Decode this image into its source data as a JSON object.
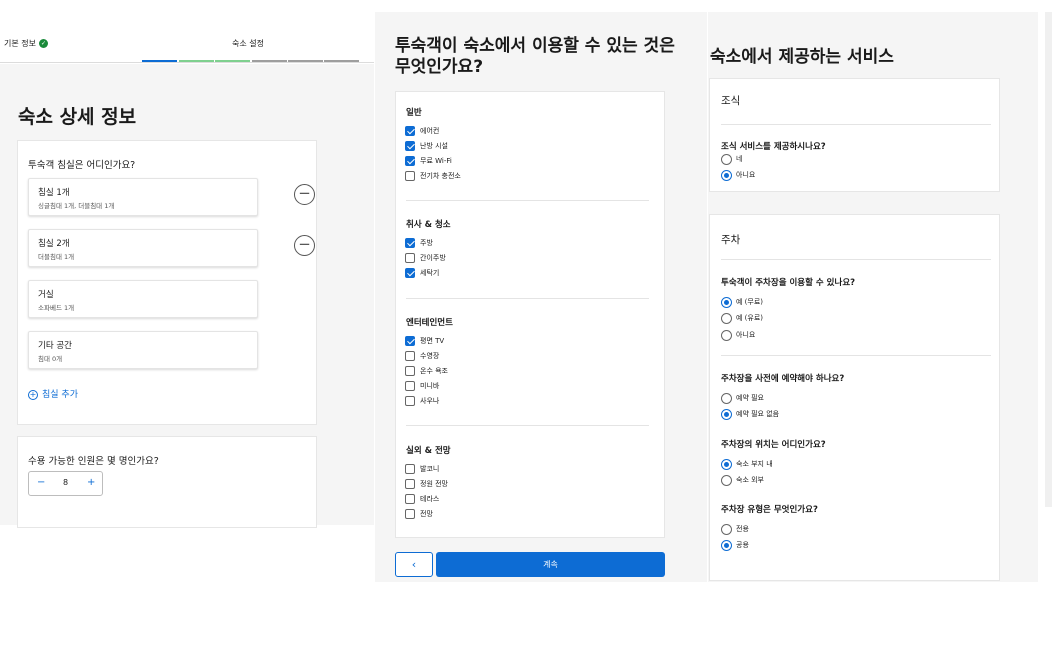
{
  "panel1": {
    "steps": {
      "basic": "기본 정보",
      "settings": "숙소 설정"
    },
    "step_colors": [
      "#0d6cd4",
      "#7fd08f",
      "#7fd08f",
      "#9e9e9e",
      "#9e9e9e",
      "#9e9e9e"
    ],
    "title": "숙소 상세 정보",
    "rooms_question": "투숙객 침실은 어디인가요?",
    "rooms": [
      {
        "title": "침실 1개",
        "sub": "싱글침대 1개, 더블침대 1개"
      },
      {
        "title": "침실 2개",
        "sub": "더블침대 1개"
      },
      {
        "title": "거실",
        "sub": "소파베드 1개"
      },
      {
        "title": "기타 공간",
        "sub": "침대 0개"
      }
    ],
    "add_room": "침실 추가",
    "guests_question": "수용 가능한 인원은 몇 명인가요?",
    "guests_value": "8",
    "minus": "−",
    "plus": "+"
  },
  "panel2": {
    "title": "투숙객이 숙소에서 이용할 수 있는 것은 무엇인가요?",
    "sections": [
      {
        "title": "일반",
        "items": [
          {
            "label": "에어컨",
            "checked": true
          },
          {
            "label": "난방 시설",
            "checked": true
          },
          {
            "label": "무료 Wi-Fi",
            "checked": true
          },
          {
            "label": "전기차 충전소",
            "checked": false
          }
        ]
      },
      {
        "title": "취사 & 청소",
        "items": [
          {
            "label": "주방",
            "checked": true
          },
          {
            "label": "간이주방",
            "checked": false
          },
          {
            "label": "세탁기",
            "checked": true
          }
        ]
      },
      {
        "title": "엔터테인먼트",
        "items": [
          {
            "label": "평면 TV",
            "checked": true
          },
          {
            "label": "수영장",
            "checked": false
          },
          {
            "label": "온수 욕조",
            "checked": false
          },
          {
            "label": "미니바",
            "checked": false
          },
          {
            "label": "사우나",
            "checked": false
          }
        ]
      },
      {
        "title": "실외 & 전망",
        "items": [
          {
            "label": "발코니",
            "checked": false
          },
          {
            "label": "정원 전망",
            "checked": false
          },
          {
            "label": "테라스",
            "checked": false
          },
          {
            "label": "전망",
            "checked": false
          }
        ]
      }
    ],
    "back": "‹",
    "next": "계속"
  },
  "panel3": {
    "title": "숙소에서 제공하는 서비스",
    "breakfast": {
      "heading": "조식",
      "question": "조식 서비스를 제공하시나요?",
      "options": [
        {
          "label": "네",
          "selected": false
        },
        {
          "label": "아니요",
          "selected": true
        }
      ]
    },
    "parking": {
      "heading": "주차",
      "q1": "투숙객이 주차장을 이용할 수 있나요?",
      "q1_options": [
        {
          "label": "예 (무료)",
          "selected": true
        },
        {
          "label": "예 (유료)",
          "selected": false
        },
        {
          "label": "아니요",
          "selected": false
        }
      ],
      "q2": "주차장을 사전에 예약해야 하나요?",
      "q2_options": [
        {
          "label": "예약 필요",
          "selected": false
        },
        {
          "label": "예약 필요 없음",
          "selected": true
        }
      ],
      "q3": "주차장의 위치는 어디인가요?",
      "q3_options": [
        {
          "label": "숙소 부지 내",
          "selected": true
        },
        {
          "label": "숙소 외부",
          "selected": false
        }
      ],
      "q4": "주차장 유형은 무엇인가요?",
      "q4_options": [
        {
          "label": "전용",
          "selected": false
        },
        {
          "label": "공용",
          "selected": true
        }
      ]
    }
  },
  "colors": {
    "accent": "#0d6cd4",
    "done": "#7fd08f",
    "check_green": "#1a8a3a"
  }
}
